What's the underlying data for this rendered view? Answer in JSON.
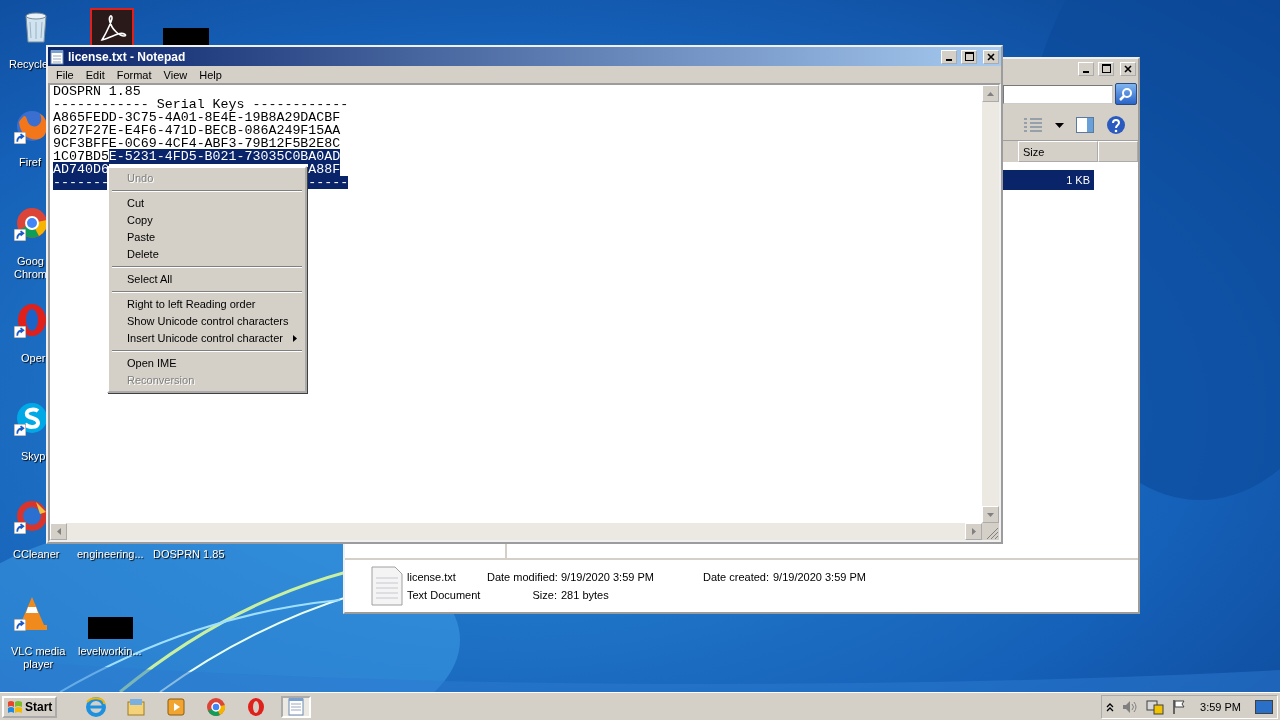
{
  "desktop": {
    "icons": [
      {
        "kind": "recycle-bin",
        "shortcut": false,
        "label": [
          "Recycle"
        ]
      },
      {
        "kind": "acrobat"
      },
      {
        "kind": "redacted"
      },
      {
        "kind": "firefox",
        "shortcut": true,
        "label": [
          "Firef"
        ]
      },
      {
        "kind": "chrome",
        "shortcut": true,
        "label": [
          "Goog",
          "Chrom"
        ]
      },
      {
        "kind": "opera",
        "shortcut": true,
        "label": [
          "Oper"
        ]
      },
      {
        "kind": "skype",
        "shortcut": true,
        "label": [
          "Skyp"
        ]
      },
      {
        "kind": "ccleaner",
        "shortcut": true,
        "label": [
          "CCleaner"
        ]
      },
      {
        "kind": "label-only",
        "label": [
          "engineering..."
        ]
      },
      {
        "kind": "label-only",
        "label": [
          "DOSPRN 1.85"
        ]
      },
      {
        "kind": "vlc",
        "shortcut": true,
        "label": [
          "VLC media",
          "player"
        ]
      },
      {
        "kind": "redacted",
        "label": [
          "levelworkin..."
        ]
      }
    ]
  },
  "explorer": {
    "columns": [
      "Size"
    ],
    "rows": [
      {
        "size": "1 KB",
        "selected": true
      }
    ],
    "details": {
      "name": "license.txt",
      "type": "Text Document",
      "fields": [
        {
          "label": "Date modified:",
          "value": "9/19/2020 3:59 PM"
        },
        {
          "label": "Size:",
          "value": "281 bytes"
        },
        {
          "label": "Date created:",
          "value": "9/19/2020 3:59 PM"
        }
      ]
    }
  },
  "notepad": {
    "title": "license.txt - Notepad",
    "menu": [
      "File",
      "Edit",
      "Format",
      "View",
      "Help"
    ],
    "lines": [
      [
        {
          "text": "DOSPRN 1.85",
          "selected": false
        }
      ],
      [
        {
          "text": "------------ Serial Keys ------------",
          "selected": false
        }
      ],
      [
        {
          "text": "A865FEDD-3C75-4A01-8E4E-19B8A29DACBF",
          "selected": false
        }
      ],
      [
        {
          "text": "6D27F27E-E4F6-471D-BECB-086A249F15AA",
          "selected": false
        }
      ],
      [
        {
          "text": "9CF3BFFE-0C69-4CF4-ABF3-79B12F5B2E8C",
          "selected": false
        }
      ],
      [
        {
          "text": "1C07BD5",
          "selected": false
        },
        {
          "text": "E-5231-4FD5-B021-73035C0BA0AD",
          "selected": true
        }
      ],
      [
        {
          "text": "AD740D6",
          "selected": true
        },
        {
          "text": "A88F",
          "selected": true,
          "kind": "after-menu"
        }
      ],
      [
        {
          "text": "-------",
          "selected": true
        },
        {
          "text": "-----",
          "selected": true,
          "kind": "after-menu"
        }
      ]
    ]
  },
  "context_menu": {
    "items": [
      {
        "kind": "item",
        "label": "Undo",
        "disabled": true
      },
      {
        "kind": "separator"
      },
      {
        "kind": "item",
        "label": "Cut",
        "disabled": false
      },
      {
        "kind": "item",
        "label": "Copy",
        "disabled": false
      },
      {
        "kind": "item",
        "label": "Paste",
        "disabled": false
      },
      {
        "kind": "item",
        "label": "Delete",
        "disabled": false
      },
      {
        "kind": "separator"
      },
      {
        "kind": "item",
        "label": "Select All",
        "disabled": false
      },
      {
        "kind": "separator"
      },
      {
        "kind": "item",
        "label": "Right to left Reading order",
        "disabled": false
      },
      {
        "kind": "item",
        "label": "Show Unicode control characters",
        "disabled": false
      },
      {
        "kind": "submenu",
        "label": "Insert Unicode control character",
        "disabled": false
      },
      {
        "kind": "separator"
      },
      {
        "kind": "item",
        "label": "Open IME",
        "disabled": false
      },
      {
        "kind": "item",
        "label": "Reconversion",
        "disabled": true
      }
    ]
  },
  "taskbar": {
    "start": "Start",
    "items": [
      {
        "kind": "ie",
        "selected": false
      },
      {
        "kind": "explorer",
        "selected": false
      },
      {
        "kind": "media-player",
        "selected": false
      },
      {
        "kind": "chrome",
        "selected": false
      },
      {
        "kind": "opera",
        "selected": false
      },
      {
        "kind": "notepad",
        "selected": true
      }
    ],
    "clock": "3:59 PM"
  }
}
